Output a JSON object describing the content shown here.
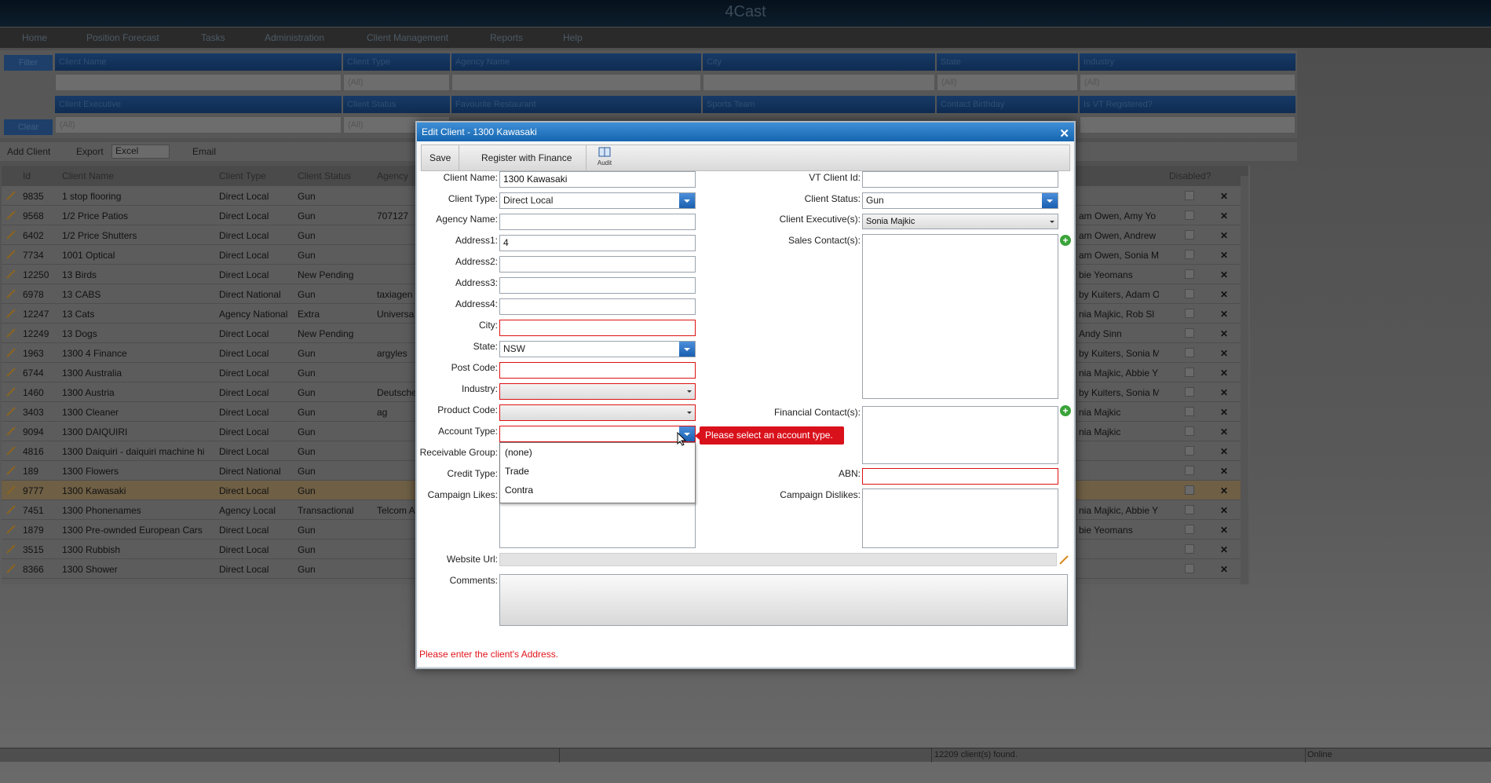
{
  "app": {
    "title": "4Cast",
    "menu": [
      "Home",
      "Position Forecast",
      "Tasks",
      "Administration",
      "Client Management",
      "Reports",
      "Help"
    ]
  },
  "filters": {
    "filter_btn": "Filter",
    "clear_btn": "Clear",
    "row1": [
      {
        "label": "Client Name",
        "value": ""
      },
      {
        "label": "Client Type",
        "value": "(All)"
      },
      {
        "label": "Agency Name",
        "value": ""
      },
      {
        "label": "City",
        "value": ""
      },
      {
        "label": "State",
        "value": "(All)"
      },
      {
        "label": "Industry",
        "value": "(All)"
      }
    ],
    "row2": [
      {
        "label": "Client Executive",
        "value": "(All)"
      },
      {
        "label": "Client Status",
        "value": "(All)"
      },
      {
        "label": "Favourite Restaurant",
        "value": ""
      },
      {
        "label": "Sports Team",
        "value": ""
      },
      {
        "label": "Contact Birthday",
        "value": ""
      },
      {
        "label": "Is VT Registered?",
        "value": ""
      }
    ]
  },
  "toolbar": {
    "add_client": "Add Client",
    "export_label": "Export",
    "export_value": "Excel",
    "email": "Email"
  },
  "grid": {
    "columns": [
      "Id",
      "Client Name",
      "Client Type",
      "Client Status",
      "Agency",
      "Disabled?"
    ],
    "rows": [
      {
        "id": "9835",
        "name": "1 stop flooring",
        "type": "Direct Local",
        "status": "Gun",
        "agency": "",
        "exec": ""
      },
      {
        "id": "9568",
        "name": "1/2 Price Patios",
        "type": "Direct Local",
        "status": "Gun",
        "agency": "707127",
        "exec": "am Owen, Amy Yo"
      },
      {
        "id": "6402",
        "name": "1/2 Price Shutters",
        "type": "Direct Local",
        "status": "Gun",
        "agency": "",
        "exec": "am Owen, Andrew"
      },
      {
        "id": "7734",
        "name": "1001 Optical",
        "type": "Direct Local",
        "status": "Gun",
        "agency": "",
        "exec": "am Owen, Sonia M"
      },
      {
        "id": "12250",
        "name": "13 Birds",
        "type": "Direct Local",
        "status": "New Pending",
        "agency": "",
        "exec": "bie Yeomans"
      },
      {
        "id": "6978",
        "name": "13 CABS",
        "type": "Direct National",
        "status": "Gun",
        "agency": "taxiagen",
        "exec": "by Kuiters, Adam O"
      },
      {
        "id": "12247",
        "name": "13 Cats",
        "type": "Agency National",
        "status": "Extra",
        "agency": "Universa",
        "exec": "nia Majkic, Rob Sl"
      },
      {
        "id": "12249",
        "name": "13 Dogs",
        "type": "Direct Local",
        "status": "New Pending",
        "agency": "",
        "exec": "Andy Sinn"
      },
      {
        "id": "1963",
        "name": "1300 4 Finance",
        "type": "Direct Local",
        "status": "Gun",
        "agency": "argyles",
        "exec": "by Kuiters, Sonia M"
      },
      {
        "id": "6744",
        "name": "1300 Australia",
        "type": "Direct Local",
        "status": "Gun",
        "agency": "",
        "exec": "nia Majkic, Abbie Y"
      },
      {
        "id": "1460",
        "name": "1300 Austria",
        "type": "Direct Local",
        "status": "Gun",
        "agency": "Deutsche",
        "exec": "by Kuiters, Sonia M"
      },
      {
        "id": "3403",
        "name": "1300 Cleaner",
        "type": "Direct Local",
        "status": "Gun",
        "agency": "ag",
        "exec": "nia Majkic"
      },
      {
        "id": "9094",
        "name": "1300 DAIQUIRI",
        "type": "Direct Local",
        "status": "Gun",
        "agency": "",
        "exec": "nia Majkic"
      },
      {
        "id": "4816",
        "name": "1300 Daiquiri - daiquiri machine hi",
        "type": "Direct Local",
        "status": "Gun",
        "agency": "",
        "exec": ""
      },
      {
        "id": "189",
        "name": "1300 Flowers",
        "type": "Direct National",
        "status": "Gun",
        "agency": "",
        "exec": ""
      },
      {
        "id": "9777",
        "name": "1300 Kawasaki",
        "type": "Direct Local",
        "status": "Gun",
        "agency": "",
        "exec": ""
      },
      {
        "id": "7451",
        "name": "1300 Phonenames",
        "type": "Agency Local",
        "status": "Transactional",
        "agency": "Telcom A",
        "exec": "nia Majkic, Abbie Y"
      },
      {
        "id": "1879",
        "name": "1300 Pre-ownded European Cars",
        "type": "Direct Local",
        "status": "Gun",
        "agency": "",
        "exec": "bie Yeomans"
      },
      {
        "id": "3515",
        "name": "1300 Rubbish",
        "type": "Direct Local",
        "status": "Gun",
        "agency": "",
        "exec": ""
      },
      {
        "id": "8366",
        "name": "1300 Shower",
        "type": "Direct Local",
        "status": "Gun",
        "agency": "",
        "exec": ""
      }
    ]
  },
  "status_bar": {
    "count": "12209 client(s) found.",
    "connection": "Online"
  },
  "dialog": {
    "title": "Edit Client - 1300 Kawasaki",
    "save": "Save",
    "register": "Register with Finance",
    "audit": "Audit",
    "labels": {
      "client_name": "Client Name:",
      "client_type": "Client Type:",
      "agency_name": "Agency Name:",
      "address1": "Address1:",
      "address2": "Address2:",
      "address3": "Address3:",
      "address4": "Address4:",
      "city": "City:",
      "state": "State:",
      "post_code": "Post Code:",
      "industry": "Industry:",
      "product_code": "Product Code:",
      "account_type": "Account Type:",
      "receivable_group": "Receivable Group:",
      "credit_type": "Credit Type:",
      "campaign_likes": "Campaign Likes:",
      "vt_client_id": "VT Client Id:",
      "client_status": "Client Status:",
      "client_executives": "Client Executive(s):",
      "sales_contacts": "Sales Contact(s):",
      "financial_contacts": "Financial Contact(s):",
      "abn": "ABN:",
      "campaign_dislikes": "Campaign Dislikes:",
      "website_url": "Website Url:",
      "comments": "Comments:"
    },
    "values": {
      "client_name": "1300 Kawasaki",
      "client_type": "Direct Local",
      "address1": "4",
      "state": "NSW",
      "client_status": "Gun",
      "client_executives": "Sonia Majkic"
    },
    "account_type_options": [
      "(none)",
      "Trade",
      "Contra"
    ],
    "tooltip": "Please select an account type.",
    "error": "Please enter the client's Address."
  }
}
